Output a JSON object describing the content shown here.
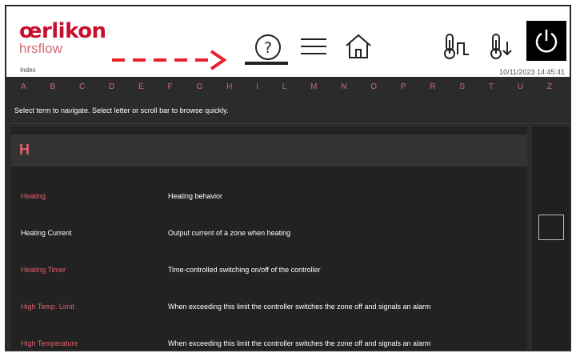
{
  "brand": {
    "name": "œrlikon",
    "product": "hrsflow"
  },
  "page": {
    "label": "Index"
  },
  "header": {
    "datetime": "10/11/2023 14:45:41",
    "icons": [
      "help-icon",
      "menu-icon",
      "home-icon",
      "temperature-icon",
      "temperature-down-icon",
      "power-icon"
    ]
  },
  "alphabet": [
    "A",
    "B",
    "C",
    "D",
    "E",
    "F",
    "G",
    "H",
    "I",
    "L",
    "M",
    "N",
    "O",
    "P",
    "R",
    "S",
    "T",
    "U",
    "Z"
  ],
  "instructions": "Select term to navigate. Select letter or scroll bar to browse quickly.",
  "section": {
    "letter": "H"
  },
  "entries": [
    {
      "term": "Heating",
      "description": "Heating behavior",
      "style": "link"
    },
    {
      "term": "Heating Current",
      "description": "Output current of a zone when heating",
      "style": "active"
    },
    {
      "term": "Heating Timer",
      "description": "Time-controlled switching on/off of the controller",
      "style": "link"
    },
    {
      "term": "High Temp. Limit",
      "description": "When exceeding this limit the controller switches the zone off and signals an alarm",
      "style": "link"
    },
    {
      "term": "High Temperature",
      "description": "When exceeding this limit the controller switches the zone off and signals an alarm",
      "style": "link"
    }
  ],
  "colors": {
    "accent": "#c8102e",
    "link": "#e0606e",
    "background": "#2b2b2b",
    "annotation": "#e8202a"
  }
}
